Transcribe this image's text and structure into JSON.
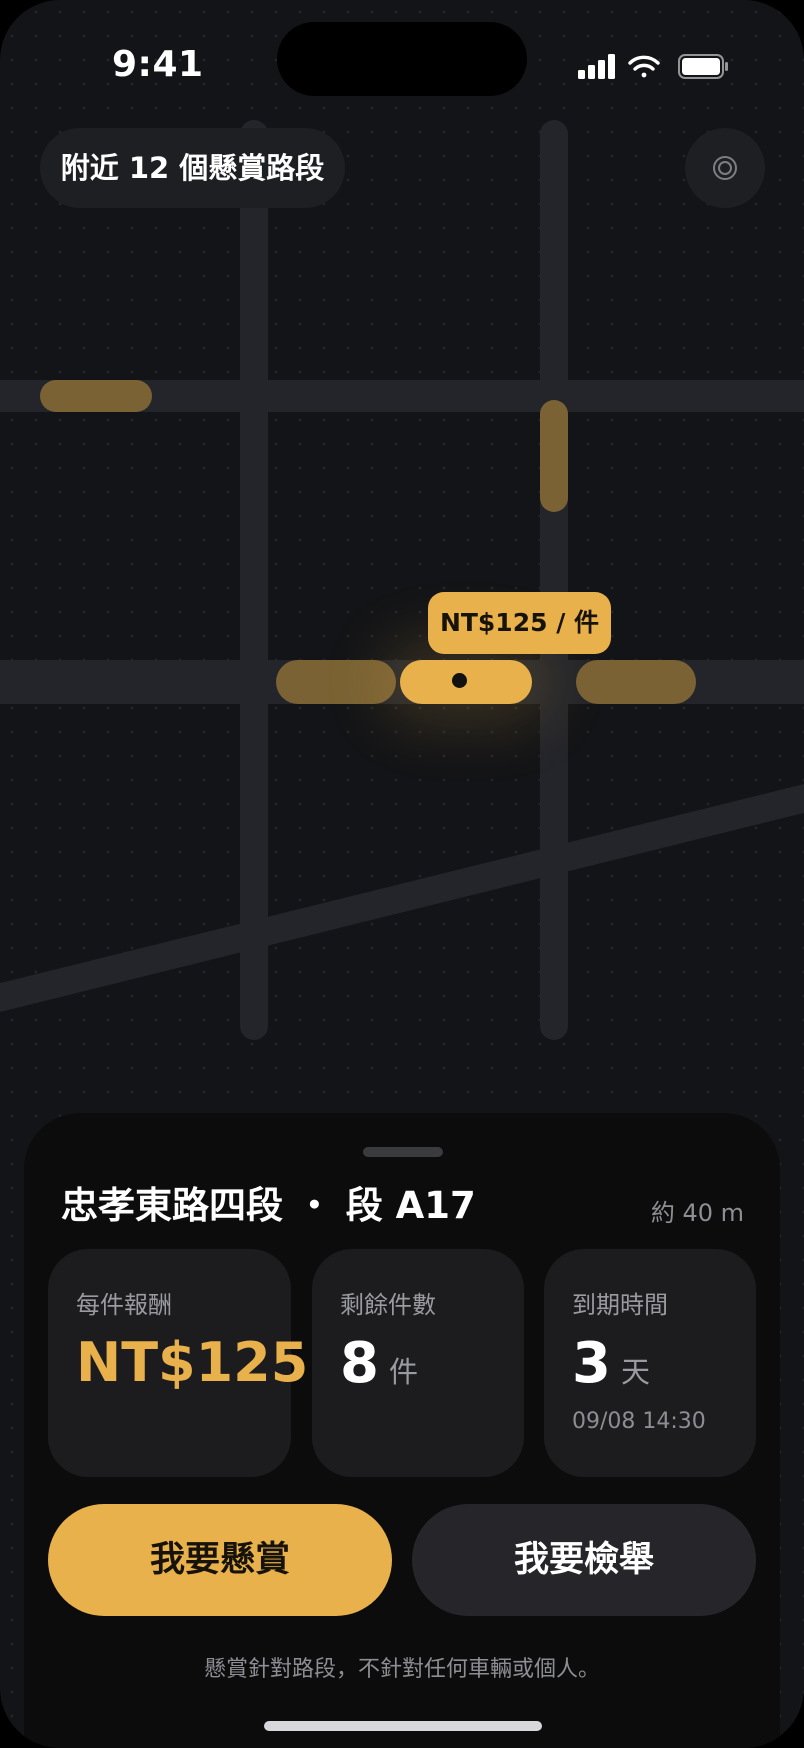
{
  "status_bar": {
    "time": "9:41"
  },
  "map": {
    "nearby_label": "附近 12 個懸賞路段",
    "selected_price_tag": "NT$125 / 件"
  },
  "sheet": {
    "title": "忠孝東路四段 ・ 段 A17",
    "distance": "約 40 m",
    "stats": {
      "reward": {
        "label": "每件報酬",
        "value": "NT$125"
      },
      "remaining": {
        "label": "剩餘件數",
        "value": "8",
        "unit": "件"
      },
      "deadline": {
        "label": "到期時間",
        "value": "3",
        "unit": "天",
        "datetime": "09/08 14:30"
      }
    },
    "primary_button": "我要懸賞",
    "secondary_button": "我要檢舉",
    "disclaimer": "懸賞針對路段，不針對任何車輛或個人。"
  },
  "colors": {
    "accent": "#e8b14b",
    "background": "#131417",
    "card": "#1c1c1f"
  }
}
